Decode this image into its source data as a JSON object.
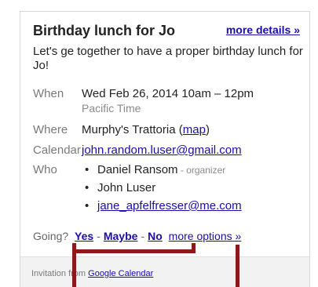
{
  "event": {
    "title": "Birthday lunch for Jo",
    "more_details_label": "more details »",
    "description": "Let's ge together to have a proper birthday lunch for Jo!"
  },
  "when": {
    "label": "When",
    "value": "Wed Feb 26, 2014 10am – 12pm",
    "timezone": "Pacific Time"
  },
  "where": {
    "label": "Where",
    "value": "Murphy's Trattoria",
    "open_paren": " (",
    "map_label": "map",
    "close_paren": ")"
  },
  "calendar": {
    "label": "Calendar",
    "value": "john.random.luser@gmail.com"
  },
  "who": {
    "label": "Who",
    "bullet": "•",
    "guests": [
      {
        "name": "Daniel Ransom",
        "note": " - organizer"
      },
      {
        "name": "John Luser"
      },
      {
        "name": "jane_apfelfresser@me.com"
      }
    ]
  },
  "rsvp": {
    "prompt": "Going?",
    "yes_label": "Yes",
    "maybe_label": "Maybe",
    "no_label": "No",
    "separator": "-",
    "more_options_label": "more options »"
  },
  "footer": {
    "prefix": "Invitation from ",
    "link_label": "Google Calendar"
  },
  "colors": {
    "link": "#1a0dab",
    "callout": "#8b1a1a"
  }
}
